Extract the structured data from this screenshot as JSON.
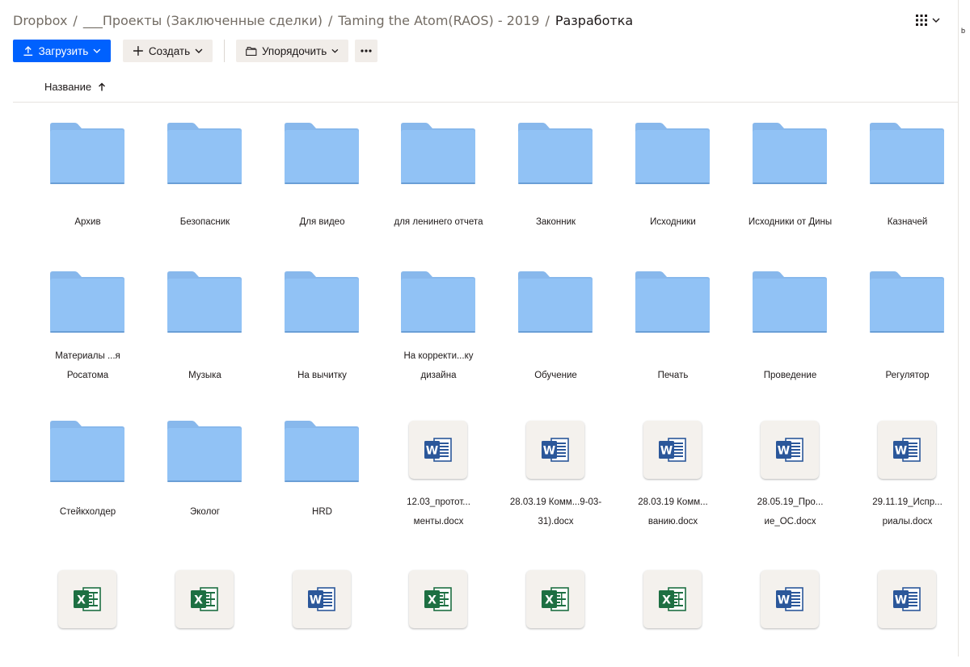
{
  "breadcrumb": {
    "items": [
      "Dropbox",
      "___Проекты (Заключенные сделки)",
      "Taming the Atom(RAOS) - 2019",
      "Разработка"
    ],
    "separator": "/"
  },
  "edge_char": "b",
  "toolbar": {
    "upload_label": "Загрузить",
    "create_label": "Создать",
    "organize_label": "Упорядочить"
  },
  "column_header": {
    "name_label": "Название",
    "sort_direction": "ascending"
  },
  "colors": {
    "accent": "#0061fe",
    "folder": "#91c2f5",
    "folder_tab": "#88b8ec",
    "word": "#2b579a",
    "excel": "#1d6f42"
  },
  "items": [
    {
      "type": "folder",
      "name_lines": [
        "Архив"
      ]
    },
    {
      "type": "folder",
      "name_lines": [
        "Безопасник"
      ]
    },
    {
      "type": "folder",
      "name_lines": [
        "Для видео"
      ]
    },
    {
      "type": "folder",
      "name_lines": [
        "для ленинего отчета"
      ]
    },
    {
      "type": "folder",
      "name_lines": [
        "Законник"
      ]
    },
    {
      "type": "folder",
      "name_lines": [
        "Исходники"
      ]
    },
    {
      "type": "folder",
      "name_lines": [
        "Исходники от Дины"
      ]
    },
    {
      "type": "folder",
      "name_lines": [
        "Казначей"
      ]
    },
    {
      "type": "folder",
      "name_lines": [
        "Материалы ...я",
        "Росатома"
      ]
    },
    {
      "type": "folder",
      "name_lines": [
        "Музыка"
      ]
    },
    {
      "type": "folder",
      "name_lines": [
        "На вычитку"
      ]
    },
    {
      "type": "folder",
      "name_lines": [
        "На корректи...ку",
        "дизайна"
      ]
    },
    {
      "type": "folder",
      "name_lines": [
        "Обучение"
      ]
    },
    {
      "type": "folder",
      "name_lines": [
        "Печать"
      ]
    },
    {
      "type": "folder",
      "name_lines": [
        "Проведение"
      ]
    },
    {
      "type": "folder",
      "name_lines": [
        "Регулятор"
      ]
    },
    {
      "type": "folder",
      "name_lines": [
        "Стейкхолдер"
      ]
    },
    {
      "type": "folder",
      "name_lines": [
        "Эколог"
      ]
    },
    {
      "type": "folder",
      "name_lines": [
        "HRD"
      ]
    },
    {
      "type": "word",
      "name_lines": [
        "12.03_протот...",
        "менты.docx"
      ]
    },
    {
      "type": "word",
      "name_lines": [
        "28.03.19 Комм...9-03-",
        "31).docx"
      ]
    },
    {
      "type": "word",
      "name_lines": [
        "28.03.19 Комм...",
        "ванию.docx"
      ]
    },
    {
      "type": "word",
      "name_lines": [
        "28.05.19_Про...",
        "ие_ОС.docx"
      ]
    },
    {
      "type": "word",
      "name_lines": [
        "29.11.19_Испр...",
        "риалы.docx"
      ]
    },
    {
      "type": "excel",
      "name_lines": []
    },
    {
      "type": "excel",
      "name_lines": []
    },
    {
      "type": "word",
      "name_lines": []
    },
    {
      "type": "excel",
      "name_lines": []
    },
    {
      "type": "excel",
      "name_lines": []
    },
    {
      "type": "excel",
      "name_lines": []
    },
    {
      "type": "word",
      "name_lines": []
    },
    {
      "type": "word",
      "name_lines": []
    }
  ]
}
